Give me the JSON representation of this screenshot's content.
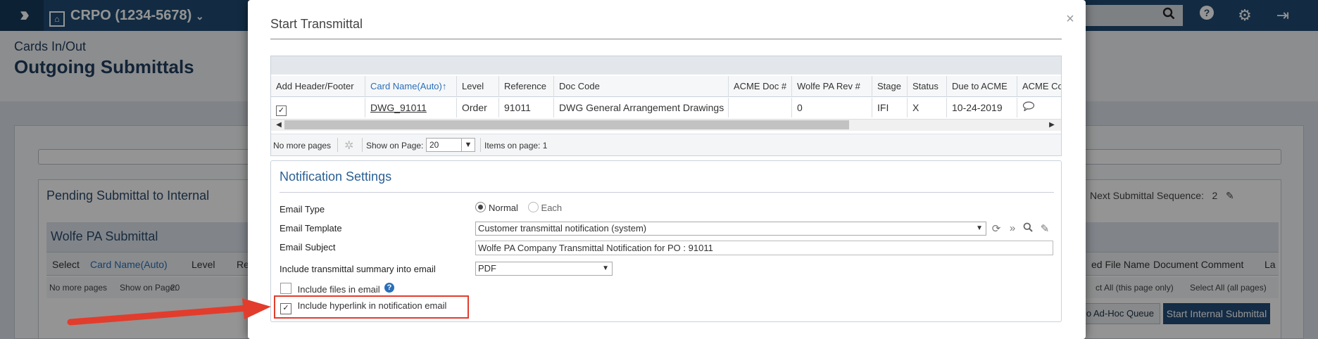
{
  "topbar": {
    "project": "CRPO (1234-5678)",
    "icons": [
      "logo-chevrons-icon",
      "search-icon",
      "help-icon",
      "gear-icon",
      "logout-icon"
    ]
  },
  "page": {
    "breadcrumb": "Cards In/Out",
    "title": "Outgoing Submittals",
    "pending_title": "Pending Submittal to Internal",
    "next_sequence_label": "Next Submittal Sequence:",
    "next_sequence_value": "2",
    "wolfe_header": "Wolfe PA Submittal",
    "columns": [
      "Select",
      "Card Name(Auto)",
      "Level",
      "Re",
      "ed File Name",
      "Document Comment",
      "La"
    ],
    "pager": {
      "no_more": "No more pages",
      "show_on_page": "Show on Page:",
      "page_size": "20",
      "select_all_page": "ct All (this page only)",
      "select_all": "Select All (all pages)"
    },
    "buttons": {
      "adhoc": "o Ad-Hoc Queue",
      "start_internal": "Start Internal Submittal"
    }
  },
  "modal": {
    "title": "Start Transmittal",
    "close": "×",
    "grid": {
      "headers": [
        "Add Header/Footer",
        "Card Name(Auto)",
        "Level",
        "Reference",
        "Doc Code",
        "ACME Doc #",
        "Wolfe PA Rev #",
        "Stage",
        "Status",
        "Due to ACME",
        "ACME Co"
      ],
      "sort_indicator": "↑",
      "row": {
        "checked": true,
        "card_name": "DWG_91011",
        "level": "Order",
        "reference": "91011",
        "doc_code": "DWG General Arrangement Drawings",
        "acme_doc": "",
        "rev": "0",
        "stage": "IFI",
        "status": "X",
        "due": "10-24-2019"
      },
      "pager": {
        "no_more": "No more pages",
        "show_on_page": "Show on Page:",
        "page_size": "20",
        "items": "Items on page: 1"
      }
    },
    "notification": {
      "title": "Notification Settings",
      "email_type_label": "Email Type",
      "email_type_options": [
        "Normal",
        "Each"
      ],
      "email_type_selected": "Normal",
      "template_label": "Email Template",
      "template_value": "Customer transmittal notification (system)",
      "subject_label": "Email Subject",
      "subject_value": "Wolfe PA Company Transmittal Notification for PO : 91011",
      "summary_label": "Include transmittal summary into email",
      "summary_value": "PDF",
      "include_files_label": "Include files in email",
      "include_files_checked": false,
      "include_hyperlink_label": "Include hyperlink in notification email",
      "include_hyperlink_checked": true
    }
  },
  "annotation": {
    "color": "#e23c2d"
  }
}
